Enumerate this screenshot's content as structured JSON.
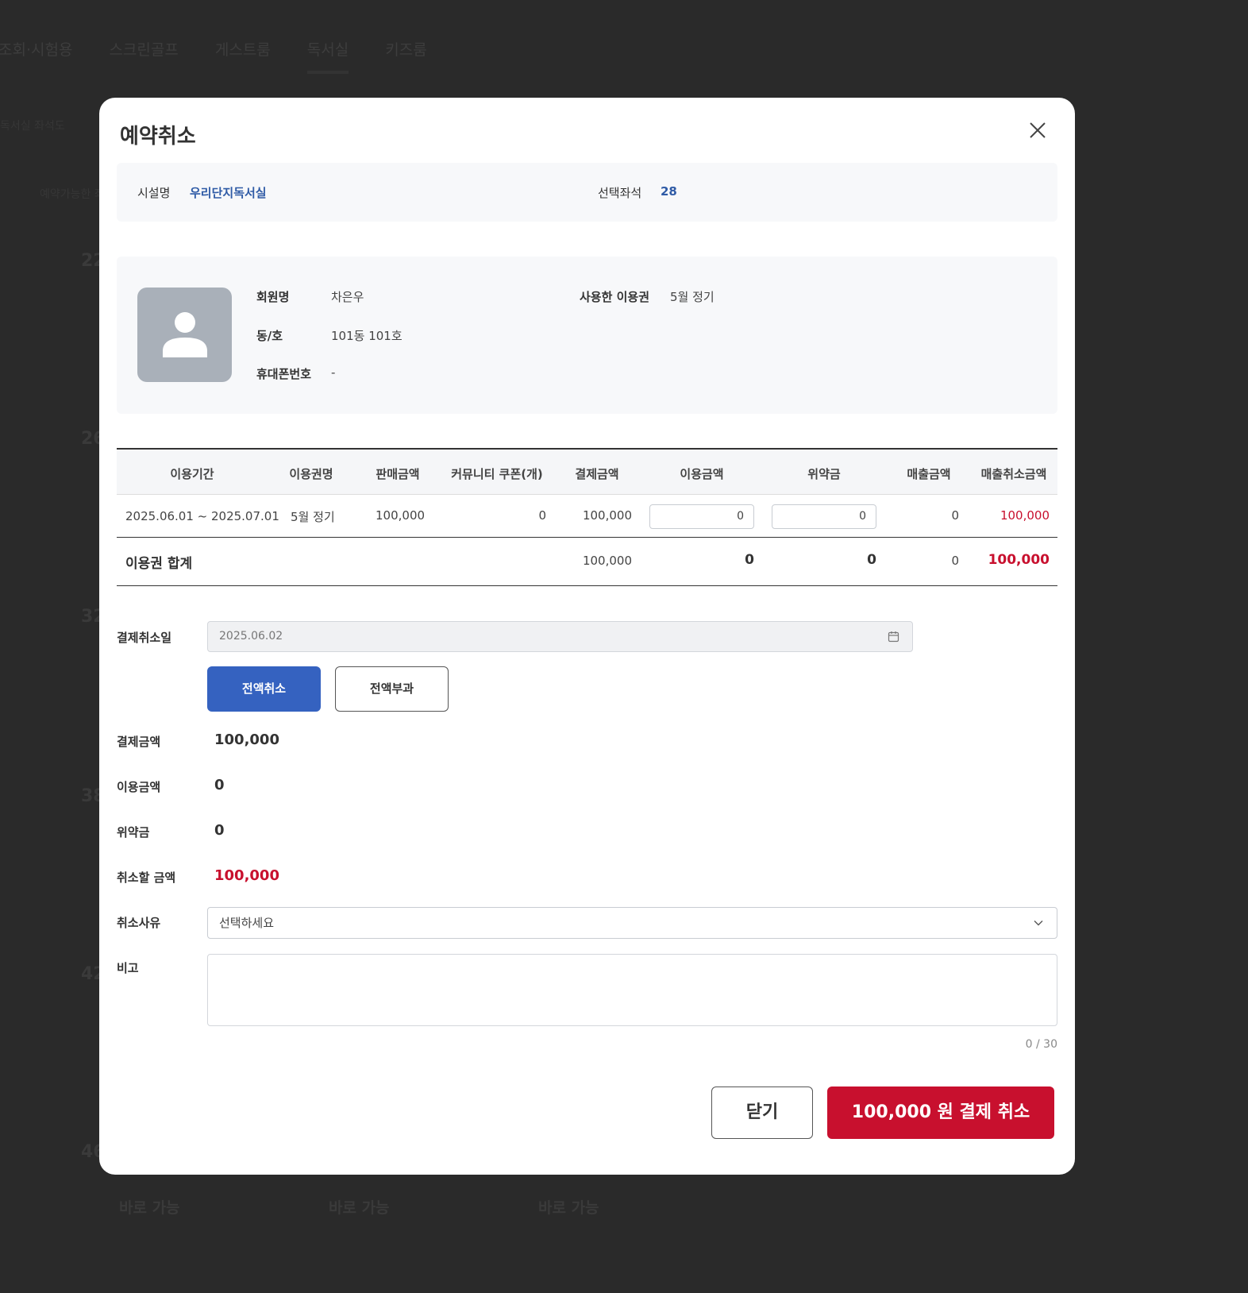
{
  "background": {
    "tabs": [
      "조회·시험용",
      "스크린골프",
      "게스트룸",
      "독서실",
      "키즈룸"
    ],
    "active_tab_index": 3,
    "sub_text": "독서실 좌석도",
    "sub_text2": "예약가능한 좌석",
    "section_numbers": [
      "22",
      "26",
      "32",
      "38",
      "42",
      "46"
    ],
    "bottom_labels": [
      "바로 가능",
      "바로 가능",
      "바로 가능"
    ]
  },
  "modal": {
    "title": "예약취소",
    "facility": {
      "name_label": "시설명",
      "name_value": "우리단지독서실",
      "seat_label": "선택좌석",
      "seat_value": "28"
    },
    "member": {
      "name_label": "회원명",
      "name_value": "차은우",
      "unit_label": "동/호",
      "unit_value": "101동 101호",
      "phone_label": "휴대폰번호",
      "phone_value": "-",
      "pass_label": "사용한 이용권",
      "pass_value": "5월 정기"
    },
    "table": {
      "headers": [
        "이용기간",
        "이용권명",
        "판매금액",
        "커뮤니티 쿠폰(개)",
        "결제금액",
        "이용금액",
        "위약금",
        "매출금액",
        "매출취소금액"
      ],
      "row": {
        "period": "2025.06.01 ~ 2025.07.01",
        "pass_name": "5월 정기",
        "sale_amount": "100,000",
        "coupon": "0",
        "paid_amount": "100,000",
        "use_amount": "0",
        "penalty": "0",
        "revenue": "0",
        "revenue_cancel": "100,000"
      },
      "summary": {
        "label": "이용권 합계",
        "paid_amount": "100,000",
        "use_amount": "0",
        "penalty": "0",
        "revenue": "0",
        "revenue_cancel": "100,000"
      }
    },
    "form": {
      "cancel_date_label": "결제취소일",
      "cancel_date_value": "2025.06.02",
      "full_cancel_button": "전액취소",
      "full_charge_button": "전액부과",
      "paid_label": "결제금액",
      "paid_value": "100,000",
      "use_label": "이용금액",
      "use_value": "0",
      "penalty_label": "위약금",
      "penalty_value": "0",
      "refund_label": "취소할 금액",
      "refund_value": "100,000",
      "reason_label": "취소사유",
      "reason_placeholder": "선택하세요",
      "memo_label": "비고",
      "memo_value": "",
      "memo_counter": "0 / 30"
    },
    "buttons": {
      "close": "닫기",
      "pay_cancel": "100,000 원 결제 취소"
    }
  },
  "colors": {
    "accent_blue": "#3562c0",
    "accent_red": "#c8102e",
    "link_blue": "#2f5ba6"
  }
}
